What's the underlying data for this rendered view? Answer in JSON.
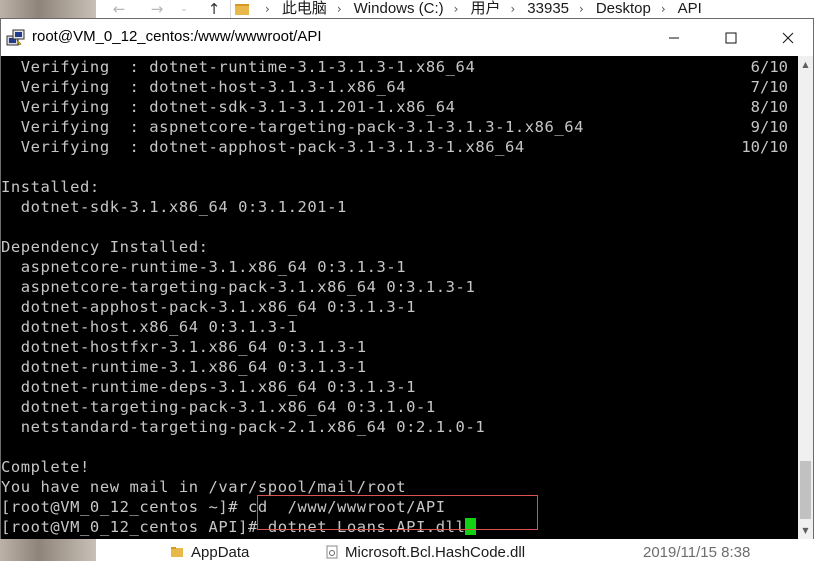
{
  "explorer": {
    "breadcrumbs": [
      "此电脑",
      "Windows (C:)",
      "用户",
      "33935",
      "Desktop",
      "API"
    ],
    "files": [
      {
        "name": "AppData"
      },
      {
        "name": "Microsoft.Bcl.HashCode.dll",
        "date": "2019/11/15 8:38"
      }
    ]
  },
  "terminal": {
    "title": "root@VM_0_12_centos:/www/wwwroot/API",
    "verify_lines": [
      {
        "text": "  Verifying  : dotnet-runtime-3.1-3.1.3-1.x86_64",
        "count": "6/10"
      },
      {
        "text": "  Verifying  : dotnet-host-3.1.3-1.x86_64",
        "count": "7/10"
      },
      {
        "text": "  Verifying  : dotnet-sdk-3.1-3.1.201-1.x86_64",
        "count": "8/10"
      },
      {
        "text": "  Verifying  : aspnetcore-targeting-pack-3.1-3.1.3-1.x86_64",
        "count": "9/10"
      },
      {
        "text": "  Verifying  : dotnet-apphost-pack-3.1-3.1.3-1.x86_64",
        "count": "10/10"
      }
    ],
    "installed_header": "Installed:",
    "installed": [
      "  dotnet-sdk-3.1.x86_64 0:3.1.201-1"
    ],
    "dependency_header": "Dependency Installed:",
    "dependencies": [
      "  aspnetcore-runtime-3.1.x86_64 0:3.1.3-1",
      "  aspnetcore-targeting-pack-3.1.x86_64 0:3.1.3-1",
      "  dotnet-apphost-pack-3.1.x86_64 0:3.1.3-1",
      "  dotnet-host.x86_64 0:3.1.3-1",
      "  dotnet-hostfxr-3.1.x86_64 0:3.1.3-1",
      "  dotnet-runtime-3.1.x86_64 0:3.1.3-1",
      "  dotnet-runtime-deps-3.1.x86_64 0:3.1.3-1",
      "  dotnet-targeting-pack-3.1.x86_64 0:3.1.0-1",
      "  netstandard-targeting-pack-2.1.x86_64 0:2.1.0-1"
    ],
    "complete": "Complete!",
    "mail": "You have new mail in /var/spool/mail/root",
    "prompt1": "[root@VM_0_12_centos ~]# cd  /www/wwwroot/API",
    "prompt2": "[root@VM_0_12_centos API]# ",
    "current_command": "dotnet Loans.API.dll",
    "cursor_color": "#12d112",
    "highlight_color": "#d9534f"
  }
}
